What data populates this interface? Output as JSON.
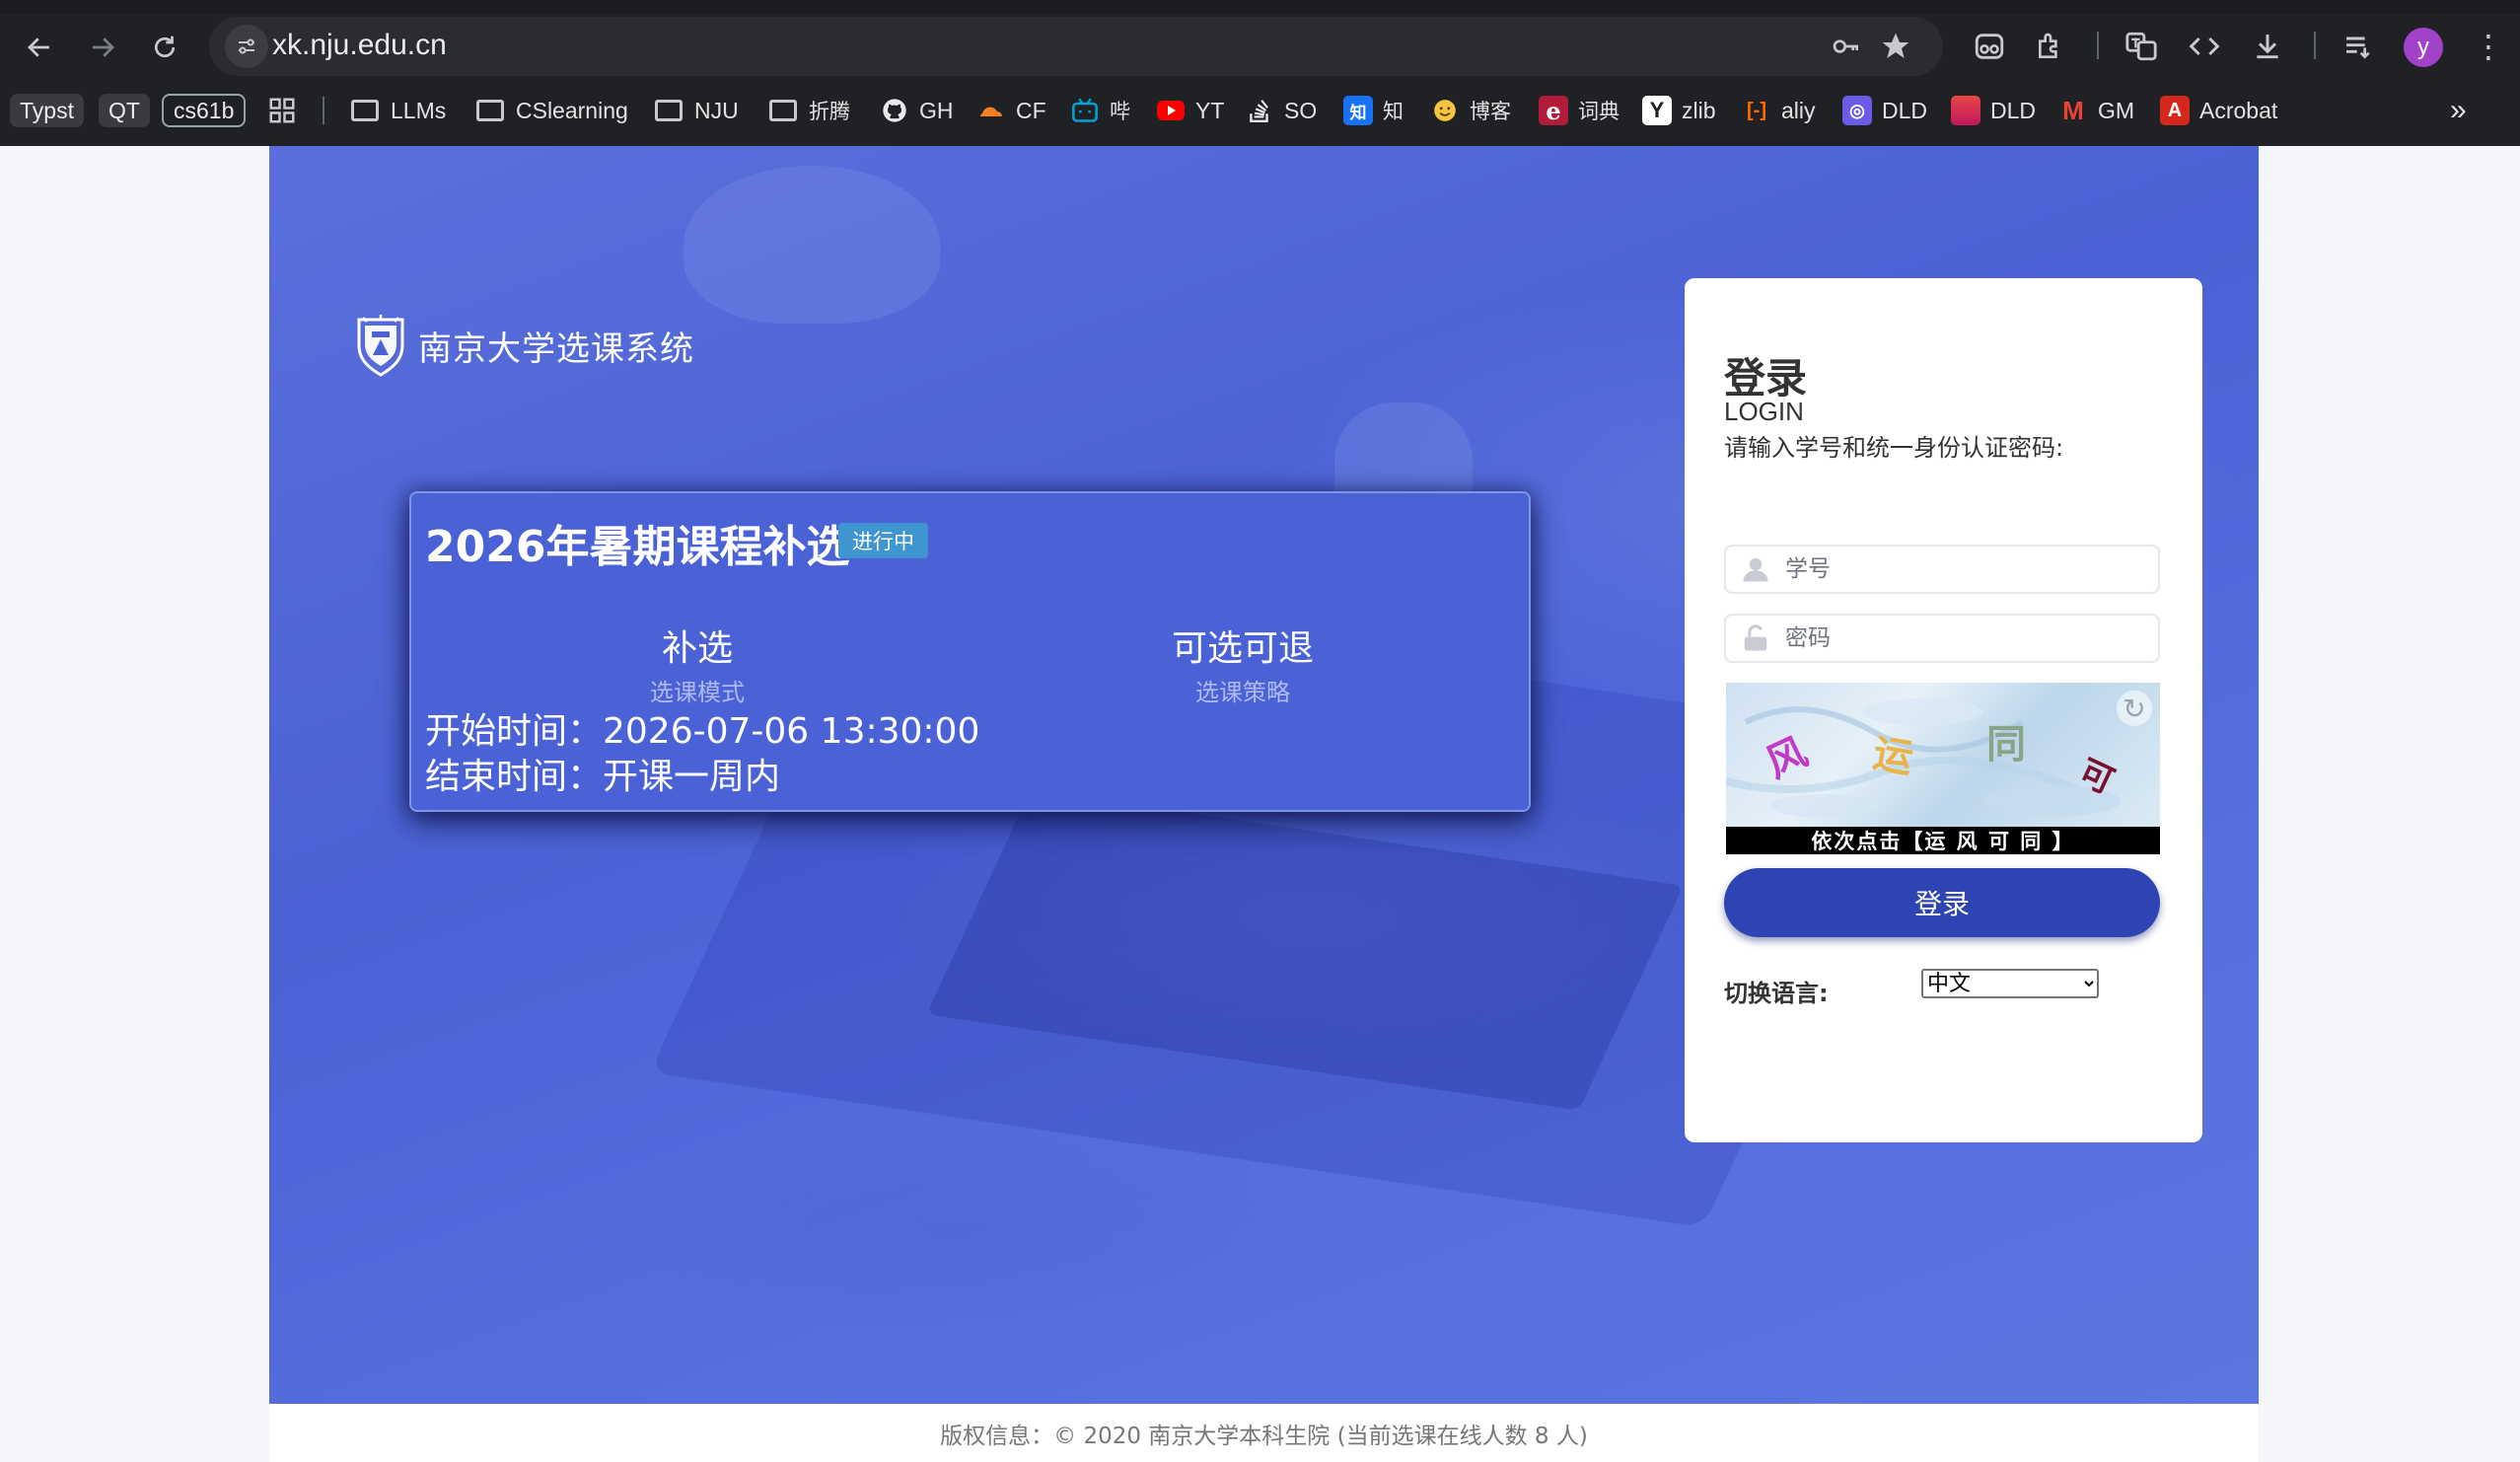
{
  "browser": {
    "url": "xk.nju.edu.cn",
    "profile_initial": "y",
    "bookmarks": {
      "typst": "Typst",
      "qt": "QT",
      "cs61b": "cs61b",
      "llms": "LLMs",
      "cslearning": "CSlearning",
      "nju": "NJU",
      "zheteng": "折腾",
      "gh": "GH",
      "cf": "CF",
      "bili": "哔",
      "yt": "YT",
      "so": "SO",
      "zhihu": "知",
      "boke": "博客",
      "cidian": "词典",
      "zlib": "zlib",
      "aliy": "aliy",
      "dld1": "DLD",
      "dld2": "DLD",
      "gm": "GM",
      "acrobat": "Acrobat"
    },
    "icon_glyphs": {
      "zhihu": "知",
      "eudic": "e",
      "zlib": "Y",
      "aliy": "[-]",
      "dld1": "◎",
      "gm": "M",
      "acrobat": "A"
    }
  },
  "page": {
    "system_title": "南京大学选课系统",
    "session": {
      "title": "2026年暑期课程补选",
      "status": "进行中",
      "mode_value": "补选",
      "mode_label": "选课模式",
      "strategy_value": "可选可退",
      "strategy_label": "选课策略",
      "start_time": "开始时间：2026-07-06 13:30:00",
      "end_time": "结束时间：开课一周内"
    },
    "login": {
      "heading": "登录",
      "subheading": "LOGIN",
      "hint": "请输入学号和统一身份认证密码:",
      "username_placeholder": "学号",
      "password_placeholder": "密码",
      "captcha_instruction": "依次点击【运 风 可 同 】",
      "captcha_chars": [
        "风",
        "运",
        "同",
        "可"
      ],
      "submit_label": "登录",
      "language_label": "切换语言:",
      "language_selected": "中文"
    },
    "footer": "版权信息：© 2020 南京大学本科生院 (当前选课在线人数 8 人)"
  },
  "colors": {
    "hero_blue": "#4b62d4",
    "card_blue": "#4a62d6",
    "login_button": "#2f44b3",
    "status_badge": "#3f95cf",
    "browser_bg": "#202124"
  }
}
